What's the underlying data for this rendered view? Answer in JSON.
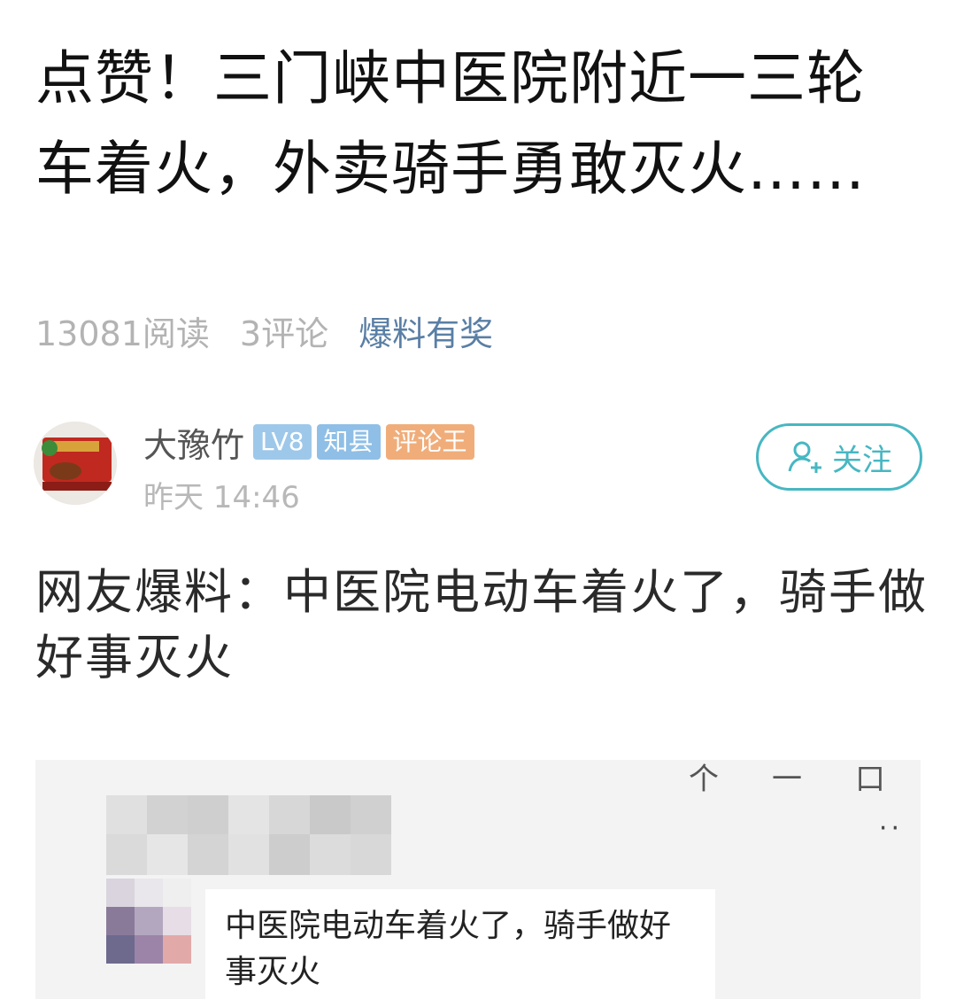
{
  "article": {
    "headline": "点赞！三门峡中医院附近一三轮车着火，外卖骑手勇敢灭火……",
    "reads": "13081阅读",
    "comments": "3评论",
    "tip_link": "爆料有奖"
  },
  "author": {
    "avatar_icon": "avatar-image",
    "name": "大豫竹",
    "badges": {
      "level": "LV8",
      "title": "知县",
      "honor": "评论王"
    },
    "time": "昨天 14:46",
    "follow_label": "关注",
    "follow_icon": "add-user-icon"
  },
  "post": {
    "text": "网友爆料：中医院电动车着火了，骑手做好事灭火"
  },
  "embedded_screenshot": {
    "window_controls": [
      "个",
      "一",
      "口"
    ],
    "more_icon": "more-dots-icon",
    "message_text": "中医院电动车着火了，骑手做好事灭火"
  },
  "colors": {
    "accent_teal": "#47b7c2",
    "tip_link": "#5a7fa5",
    "badge_blue": "#9ec8ea",
    "badge_orange": "#f0ad7a"
  }
}
